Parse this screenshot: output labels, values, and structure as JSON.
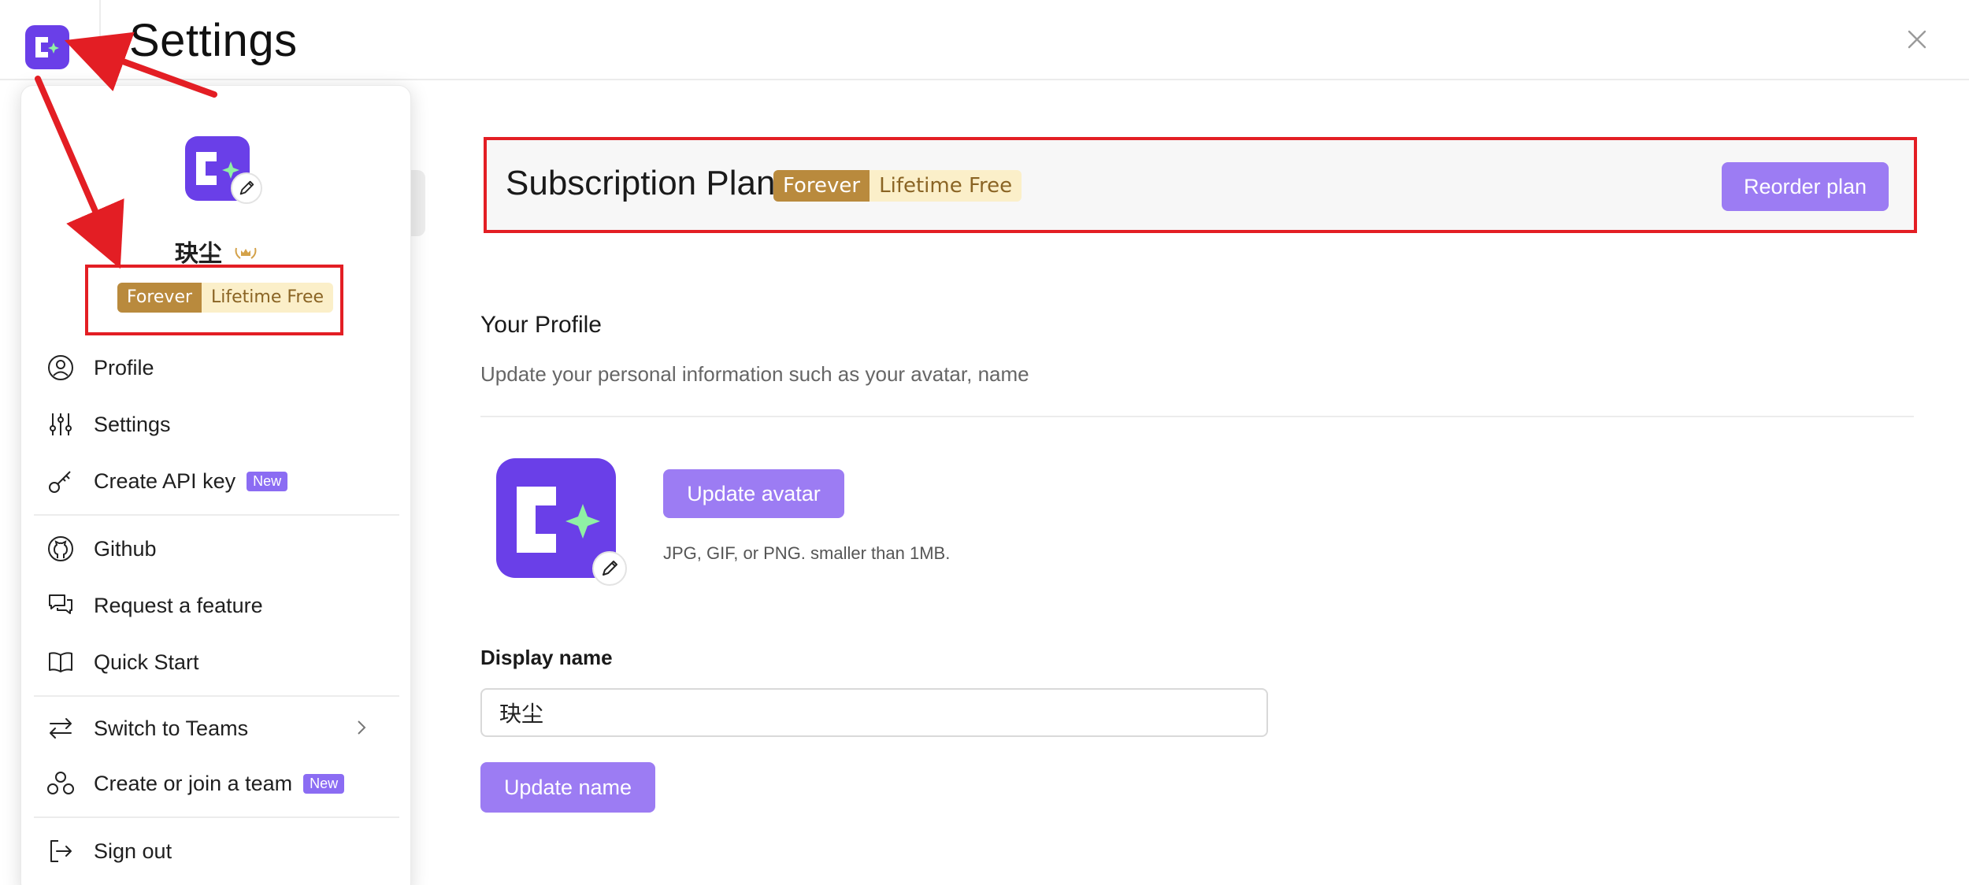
{
  "header": {
    "title": "Settings"
  },
  "menu": {
    "user_name": "玦尘",
    "badge": {
      "left": "Forever",
      "right": "Lifetime Free"
    },
    "items": [
      {
        "label": "Profile",
        "icon": "user-circle-icon"
      },
      {
        "label": "Settings",
        "icon": "sliders-icon"
      },
      {
        "label": "Create API key",
        "icon": "key-icon",
        "tag": "New"
      },
      {
        "label": "Github",
        "icon": "github-icon"
      },
      {
        "label": "Request a feature",
        "icon": "chat-bubbles-icon"
      },
      {
        "label": "Quick Start",
        "icon": "book-icon"
      },
      {
        "label": "Switch to Teams",
        "icon": "swap-arrows-icon"
      },
      {
        "label": "Create or join a team",
        "icon": "team-icon",
        "tag": "New"
      },
      {
        "label": "Sign out",
        "icon": "sign-out-icon"
      }
    ]
  },
  "subscription": {
    "title": "Subscription Plan",
    "badge": {
      "left": "Forever",
      "right": "Lifetime Free"
    },
    "button": "Reorder plan"
  },
  "profile": {
    "title": "Your Profile",
    "description": "Update your personal information such as your avatar, name",
    "update_avatar_button": "Update avatar",
    "avatar_hint": "JPG, GIF, or PNG. smaller than 1MB.",
    "display_name_label": "Display name",
    "display_name_value": "玦尘",
    "update_name_button": "Update name"
  },
  "colors": {
    "brand_purple": "#6a3fe8",
    "button_purple": "#9c7cf3",
    "badge_gold": "#b98a3d",
    "badge_cream": "#fbefc9",
    "annotation_red": "#e31e24"
  }
}
